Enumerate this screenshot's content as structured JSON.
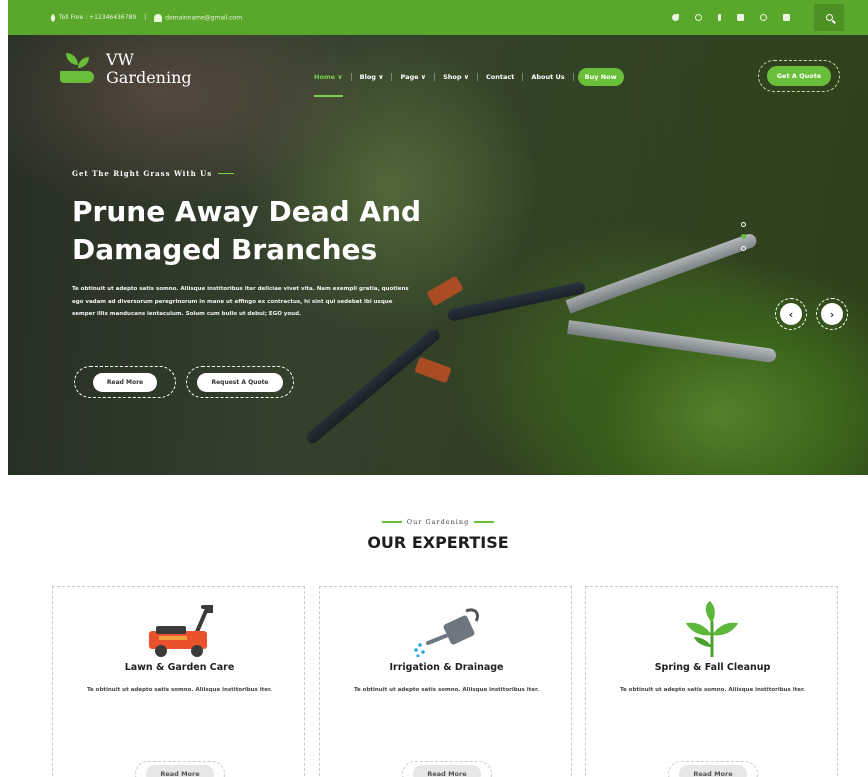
{
  "topbar": {
    "toll_free": "Toll Free : +12346436789",
    "separator": "|",
    "email": "domainname@gmail.com",
    "socials": [
      "twitter-icon",
      "instagram-icon",
      "facebook-icon",
      "youtube-icon",
      "pinterest-icon",
      "linkedin-icon"
    ],
    "search_icon": "search-icon"
  },
  "brand": {
    "line1": "VW",
    "line2": "Gardening"
  },
  "nav": {
    "items": [
      {
        "label": "Home ∨",
        "active": true
      },
      {
        "label": "Blog ∨",
        "active": false
      },
      {
        "label": "Page ∨",
        "active": false
      },
      {
        "label": "Shop ∨",
        "active": false
      },
      {
        "label": "Contact",
        "active": false
      },
      {
        "label": "About Us",
        "active": false
      }
    ],
    "buy_now": "Buy Now",
    "quote": "Get A Quote"
  },
  "hero": {
    "eyebrow": "Get The Right Grass With Us",
    "title": "Prune Away Dead And Damaged Branches",
    "description": "Te obtinuit ut adepto satis somno. Aliisque institoribus iter deliciae vivet vita. Nam exempli gratia, quotiens ego vadam ad diversorum peregrinorum in mane ut effingo ex contractus, hi sint qui sedebat ibi usque semper illis manducans ientaculum. Solum cum bullo ut debui; EGO youd.",
    "read_more": "Read More",
    "request_quote": "Request A Quote",
    "slider_dots": 3,
    "active_dot": 2,
    "prev_icon": "‹",
    "next_icon": "›"
  },
  "expertise": {
    "eyebrow": "Our Gardening",
    "title": "OUR EXPERTISE",
    "cards": [
      {
        "icon": "lawn-mower-icon",
        "title": "Lawn & Garden Care",
        "text": "Te obtinuit ut adepto satis somno. Aliisque institoribus iter.",
        "button": "Read More"
      },
      {
        "icon": "watering-can-icon",
        "title": "Irrigation & Drainage",
        "text": "Te obtinuit ut adepto satis somno. Aliisque institoribus iter.",
        "button": "Read More"
      },
      {
        "icon": "plant-sprout-icon",
        "title": "Spring & Fall Cleanup",
        "text": "Te obtinuit ut adepto satis somno. Aliisque institoribus iter.",
        "button": "Read More"
      }
    ]
  },
  "colors": {
    "brand_green": "#5aa82b",
    "accent_green": "#6abf3a",
    "heading": "#1d1d1d"
  }
}
